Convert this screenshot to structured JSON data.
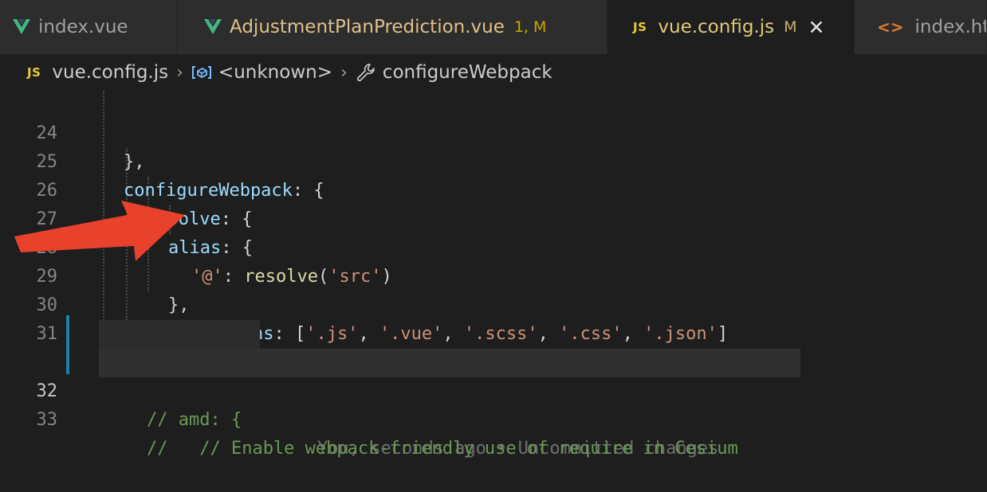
{
  "tabs": [
    {
      "label": "index.vue",
      "icon": "vue-icon",
      "status": "",
      "active": false
    },
    {
      "label": "AdjustmentPlanPrediction.vue",
      "icon": "vue-icon",
      "status": "1, M",
      "active": false
    },
    {
      "label": "vue.config.js",
      "icon": "js-icon",
      "icon_text": "JS",
      "status": "M",
      "active": true,
      "close": "✕"
    },
    {
      "label": "index.htm",
      "icon": "html-icon",
      "icon_text": "<>",
      "status": "",
      "active": false
    }
  ],
  "breadcrumb": {
    "file_icon_text": "JS",
    "file": "vue.config.js",
    "symbol": "<unknown>",
    "method": "configureWebpack"
  },
  "editor": {
    "lines": [
      {
        "num": "24",
        "text": "},"
      },
      {
        "num": "25",
        "key": "configureWebpack",
        "punct": ": {"
      },
      {
        "num": "26",
        "key": "resolve",
        "punct": ": {"
      },
      {
        "num": "27",
        "key": "alias",
        "punct": ": {"
      },
      {
        "num": "28",
        "str": "'@'",
        "punct": ": ",
        "func": "resolve",
        "arg": "'src'"
      },
      {
        "num": "29",
        "text": "},"
      },
      {
        "num": "30",
        "key": "extensions",
        "punct": ": [",
        "items": [
          "'.js'",
          "'.vue'",
          "'.scss'",
          "'.css'",
          "'.json'"
        ],
        "end": "]"
      },
      {
        "num": "31",
        "text": "},"
      },
      {
        "num": "32",
        "comment": "// amd: {",
        "blame": "You, seconds ago • Uncommitted changes"
      },
      {
        "num": "33",
        "comment": "//   // Enable webpack-friendly use of require in Cesium"
      }
    ],
    "current_line": "32"
  },
  "colors": {
    "git_modified_bar": "#1b81a8",
    "annotation_arrow": "#e8412c",
    "active_tab_title": "#e3c97a"
  }
}
